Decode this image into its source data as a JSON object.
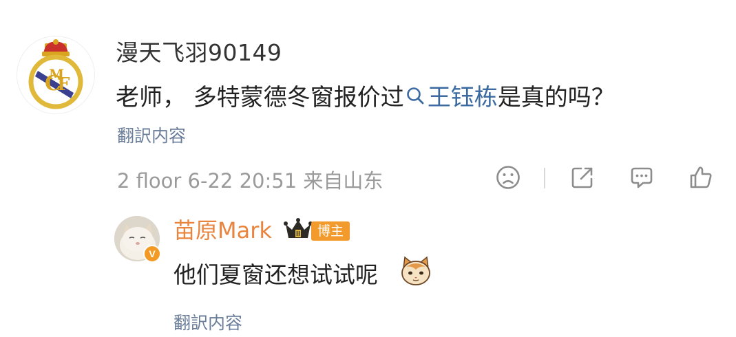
{
  "comment": {
    "username": "漫天飞羽90149",
    "text_before": "老师， 多特蒙德冬窗报价过",
    "topic": "王钰栋",
    "text_after": "是真的吗？",
    "translate_label": "翻訳内容",
    "meta": "2 floor 6-22 20:51 来自山东",
    "actions": [
      "sad-face-icon",
      "share-icon",
      "comment-icon",
      "like-icon"
    ]
  },
  "reply": {
    "username": "苗原Mark",
    "badge": "博主",
    "text": "他们夏窗还想试试呢",
    "translate_label": "翻訳内容",
    "verified_glyph": "V"
  },
  "colors": {
    "link": "#3b6aa0",
    "reply_name": "#e8843d",
    "badge_bg": "#f39a2c",
    "meta_gray": "#9a9a9a"
  }
}
